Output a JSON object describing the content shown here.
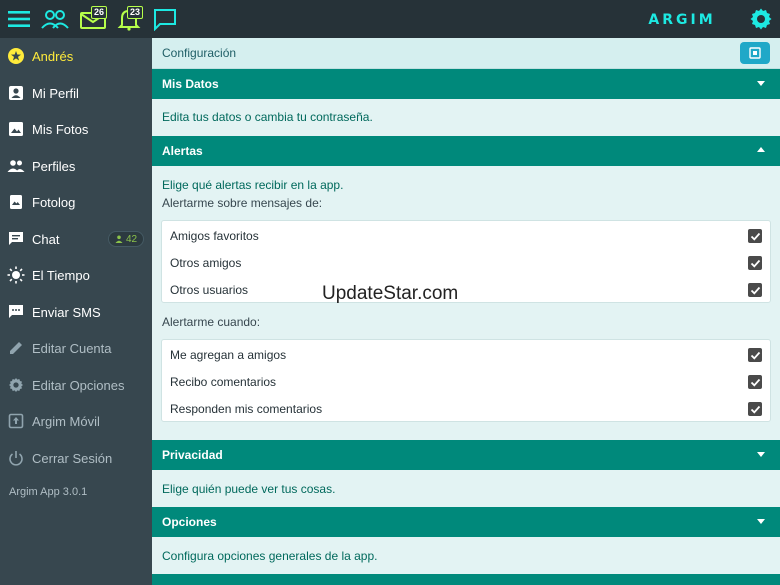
{
  "topbar": {
    "messages_count": "26",
    "alerts_count": "23",
    "logo_text": "ARGIM",
    "accent_color": "#1de9e2"
  },
  "sidebar": {
    "items": [
      {
        "label": "Andrés",
        "icon": "star-icon"
      },
      {
        "label": "Mi Perfil",
        "icon": "profile-icon"
      },
      {
        "label": "Mis Fotos",
        "icon": "photo-icon"
      },
      {
        "label": "Perfiles",
        "icon": "people-icon"
      },
      {
        "label": "Fotolog",
        "icon": "fotolog-icon"
      },
      {
        "label": "Chat",
        "icon": "chat-icon",
        "badge": "42"
      },
      {
        "label": "El Tiempo",
        "icon": "sun-icon"
      },
      {
        "label": "Enviar SMS",
        "icon": "sms-icon"
      },
      {
        "label": "Editar Cuenta",
        "icon": "pencil-icon"
      },
      {
        "label": "Editar Opciones",
        "icon": "gear-icon"
      },
      {
        "label": "Argim Móvil",
        "icon": "mobile-icon"
      },
      {
        "label": "Cerrar Sesión",
        "icon": "power-icon"
      }
    ],
    "version": "Argim App 3.0.1"
  },
  "main": {
    "title": "Configuración",
    "sections": {
      "mis_datos": {
        "title": "Mis Datos",
        "desc": "Edita tus datos o cambia tu contraseña."
      },
      "alertas": {
        "title": "Alertas",
        "desc": "Elige qué alertas recibir en la app.",
        "group1_label": "Alertarme sobre mensajes de:",
        "group1": [
          {
            "label": "Amigos favoritos",
            "checked": true
          },
          {
            "label": "Otros amigos",
            "checked": true
          },
          {
            "label": "Otros usuarios",
            "checked": true
          }
        ],
        "group2_label": "Alertarme cuando:",
        "group2": [
          {
            "label": "Me agregan a amigos",
            "checked": true
          },
          {
            "label": "Recibo comentarios",
            "checked": true
          },
          {
            "label": "Responden mis comentarios",
            "checked": true
          }
        ]
      },
      "privacidad": {
        "title": "Privacidad",
        "desc": "Elige quién puede ver tus cosas."
      },
      "opciones": {
        "title": "Opciones",
        "desc": "Configura opciones generales de la app."
      }
    }
  },
  "watermark": "UpdateStar.com"
}
